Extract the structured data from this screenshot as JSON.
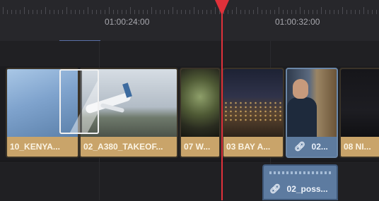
{
  "ruler": {
    "timecodes": [
      "01:00:24:00",
      "01:00:32:00"
    ]
  },
  "clips": [
    {
      "name": "10_KENYA...",
      "type": "video"
    },
    {
      "name": "02_A380_TAKEOF...",
      "type": "video"
    },
    {
      "name": "07 W...",
      "type": "video"
    },
    {
      "name": "03 BAY A...",
      "type": "video"
    },
    {
      "name": "02...",
      "type": "linked-video"
    },
    {
      "name": "08 NI...",
      "type": "video"
    }
  ],
  "audio_clips": [
    {
      "name": "02_poss...",
      "type": "linked-audio"
    }
  ],
  "icons": {
    "link": "link-icon",
    "playhead": "playhead-icon"
  },
  "colors": {
    "clip_video": "#c9a46a",
    "clip_linked": "#5e7b9e",
    "playhead": "#e0313a",
    "background": "#1f1f22"
  }
}
